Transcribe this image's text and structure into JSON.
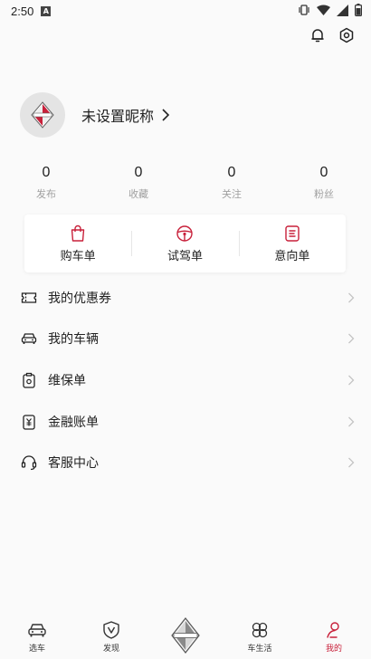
{
  "status_bar": {
    "time": "2:50",
    "notif_letter": "A"
  },
  "profile": {
    "nickname": "未设置昵称"
  },
  "stats": [
    {
      "value": "0",
      "label": "发布"
    },
    {
      "value": "0",
      "label": "收藏"
    },
    {
      "value": "0",
      "label": "关注"
    },
    {
      "value": "0",
      "label": "粉丝"
    }
  ],
  "orders": [
    {
      "label": "购车单",
      "icon": "shopping-bag-icon"
    },
    {
      "label": "试驾单",
      "icon": "steering-wheel-icon"
    },
    {
      "label": "意向单",
      "icon": "document-icon"
    }
  ],
  "menu": [
    {
      "label": "我的优惠券",
      "icon": "coupon-icon"
    },
    {
      "label": "我的车辆",
      "icon": "car-icon"
    },
    {
      "label": "维保单",
      "icon": "maintenance-icon"
    },
    {
      "label": "金融账单",
      "icon": "finance-bill-icon"
    },
    {
      "label": "客服中心",
      "icon": "headset-icon"
    }
  ],
  "nav": [
    {
      "label": "选车",
      "icon": "car-icon"
    },
    {
      "label": "发现",
      "icon": "discover-shield-icon"
    },
    {
      "label": "",
      "icon": "brand-logo"
    },
    {
      "label": "车生活",
      "icon": "clover-icon"
    },
    {
      "label": "我的",
      "icon": "person-icon",
      "active": true
    }
  ],
  "colors": {
    "accent": "#c8203a",
    "background": "#fafafa",
    "card": "#ffffff",
    "muted": "#a0a0a0"
  }
}
